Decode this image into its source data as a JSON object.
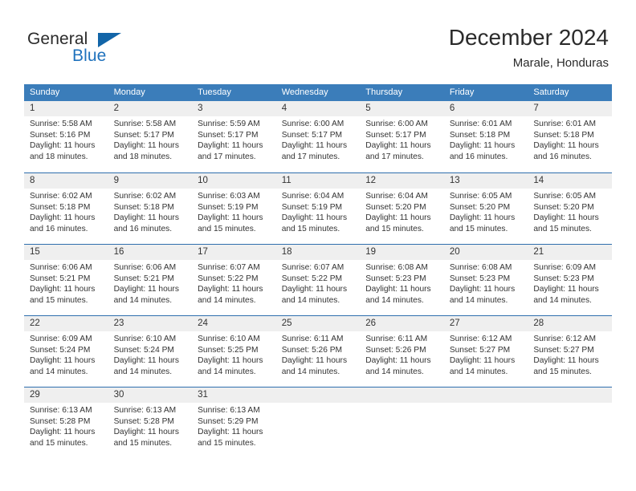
{
  "brand": {
    "name_part1": "General",
    "name_part2": "Blue",
    "accent_color": "#1265a8"
  },
  "header": {
    "title": "December 2024",
    "subtitle": "Marale, Honduras"
  },
  "theme": {
    "header_row_bg": "#3b7dba",
    "week_separator": "#2f6fae",
    "daynum_band_bg": "#efefef"
  },
  "weekdays": [
    "Sunday",
    "Monday",
    "Tuesday",
    "Wednesday",
    "Thursday",
    "Friday",
    "Saturday"
  ],
  "weeks": [
    [
      {
        "day": "1",
        "sunrise": "Sunrise: 5:58 AM",
        "sunset": "Sunset: 5:16 PM",
        "daylight1": "Daylight: 11 hours",
        "daylight2": "and 18 minutes."
      },
      {
        "day": "2",
        "sunrise": "Sunrise: 5:58 AM",
        "sunset": "Sunset: 5:17 PM",
        "daylight1": "Daylight: 11 hours",
        "daylight2": "and 18 minutes."
      },
      {
        "day": "3",
        "sunrise": "Sunrise: 5:59 AM",
        "sunset": "Sunset: 5:17 PM",
        "daylight1": "Daylight: 11 hours",
        "daylight2": "and 17 minutes."
      },
      {
        "day": "4",
        "sunrise": "Sunrise: 6:00 AM",
        "sunset": "Sunset: 5:17 PM",
        "daylight1": "Daylight: 11 hours",
        "daylight2": "and 17 minutes."
      },
      {
        "day": "5",
        "sunrise": "Sunrise: 6:00 AM",
        "sunset": "Sunset: 5:17 PM",
        "daylight1": "Daylight: 11 hours",
        "daylight2": "and 17 minutes."
      },
      {
        "day": "6",
        "sunrise": "Sunrise: 6:01 AM",
        "sunset": "Sunset: 5:18 PM",
        "daylight1": "Daylight: 11 hours",
        "daylight2": "and 16 minutes."
      },
      {
        "day": "7",
        "sunrise": "Sunrise: 6:01 AM",
        "sunset": "Sunset: 5:18 PM",
        "daylight1": "Daylight: 11 hours",
        "daylight2": "and 16 minutes."
      }
    ],
    [
      {
        "day": "8",
        "sunrise": "Sunrise: 6:02 AM",
        "sunset": "Sunset: 5:18 PM",
        "daylight1": "Daylight: 11 hours",
        "daylight2": "and 16 minutes."
      },
      {
        "day": "9",
        "sunrise": "Sunrise: 6:02 AM",
        "sunset": "Sunset: 5:18 PM",
        "daylight1": "Daylight: 11 hours",
        "daylight2": "and 16 minutes."
      },
      {
        "day": "10",
        "sunrise": "Sunrise: 6:03 AM",
        "sunset": "Sunset: 5:19 PM",
        "daylight1": "Daylight: 11 hours",
        "daylight2": "and 15 minutes."
      },
      {
        "day": "11",
        "sunrise": "Sunrise: 6:04 AM",
        "sunset": "Sunset: 5:19 PM",
        "daylight1": "Daylight: 11 hours",
        "daylight2": "and 15 minutes."
      },
      {
        "day": "12",
        "sunrise": "Sunrise: 6:04 AM",
        "sunset": "Sunset: 5:20 PM",
        "daylight1": "Daylight: 11 hours",
        "daylight2": "and 15 minutes."
      },
      {
        "day": "13",
        "sunrise": "Sunrise: 6:05 AM",
        "sunset": "Sunset: 5:20 PM",
        "daylight1": "Daylight: 11 hours",
        "daylight2": "and 15 minutes."
      },
      {
        "day": "14",
        "sunrise": "Sunrise: 6:05 AM",
        "sunset": "Sunset: 5:20 PM",
        "daylight1": "Daylight: 11 hours",
        "daylight2": "and 15 minutes."
      }
    ],
    [
      {
        "day": "15",
        "sunrise": "Sunrise: 6:06 AM",
        "sunset": "Sunset: 5:21 PM",
        "daylight1": "Daylight: 11 hours",
        "daylight2": "and 15 minutes."
      },
      {
        "day": "16",
        "sunrise": "Sunrise: 6:06 AM",
        "sunset": "Sunset: 5:21 PM",
        "daylight1": "Daylight: 11 hours",
        "daylight2": "and 14 minutes."
      },
      {
        "day": "17",
        "sunrise": "Sunrise: 6:07 AM",
        "sunset": "Sunset: 5:22 PM",
        "daylight1": "Daylight: 11 hours",
        "daylight2": "and 14 minutes."
      },
      {
        "day": "18",
        "sunrise": "Sunrise: 6:07 AM",
        "sunset": "Sunset: 5:22 PM",
        "daylight1": "Daylight: 11 hours",
        "daylight2": "and 14 minutes."
      },
      {
        "day": "19",
        "sunrise": "Sunrise: 6:08 AM",
        "sunset": "Sunset: 5:23 PM",
        "daylight1": "Daylight: 11 hours",
        "daylight2": "and 14 minutes."
      },
      {
        "day": "20",
        "sunrise": "Sunrise: 6:08 AM",
        "sunset": "Sunset: 5:23 PM",
        "daylight1": "Daylight: 11 hours",
        "daylight2": "and 14 minutes."
      },
      {
        "day": "21",
        "sunrise": "Sunrise: 6:09 AM",
        "sunset": "Sunset: 5:23 PM",
        "daylight1": "Daylight: 11 hours",
        "daylight2": "and 14 minutes."
      }
    ],
    [
      {
        "day": "22",
        "sunrise": "Sunrise: 6:09 AM",
        "sunset": "Sunset: 5:24 PM",
        "daylight1": "Daylight: 11 hours",
        "daylight2": "and 14 minutes."
      },
      {
        "day": "23",
        "sunrise": "Sunrise: 6:10 AM",
        "sunset": "Sunset: 5:24 PM",
        "daylight1": "Daylight: 11 hours",
        "daylight2": "and 14 minutes."
      },
      {
        "day": "24",
        "sunrise": "Sunrise: 6:10 AM",
        "sunset": "Sunset: 5:25 PM",
        "daylight1": "Daylight: 11 hours",
        "daylight2": "and 14 minutes."
      },
      {
        "day": "25",
        "sunrise": "Sunrise: 6:11 AM",
        "sunset": "Sunset: 5:26 PM",
        "daylight1": "Daylight: 11 hours",
        "daylight2": "and 14 minutes."
      },
      {
        "day": "26",
        "sunrise": "Sunrise: 6:11 AM",
        "sunset": "Sunset: 5:26 PM",
        "daylight1": "Daylight: 11 hours",
        "daylight2": "and 14 minutes."
      },
      {
        "day": "27",
        "sunrise": "Sunrise: 6:12 AM",
        "sunset": "Sunset: 5:27 PM",
        "daylight1": "Daylight: 11 hours",
        "daylight2": "and 14 minutes."
      },
      {
        "day": "28",
        "sunrise": "Sunrise: 6:12 AM",
        "sunset": "Sunset: 5:27 PM",
        "daylight1": "Daylight: 11 hours",
        "daylight2": "and 15 minutes."
      }
    ],
    [
      {
        "day": "29",
        "sunrise": "Sunrise: 6:13 AM",
        "sunset": "Sunset: 5:28 PM",
        "daylight1": "Daylight: 11 hours",
        "daylight2": "and 15 minutes."
      },
      {
        "day": "30",
        "sunrise": "Sunrise: 6:13 AM",
        "sunset": "Sunset: 5:28 PM",
        "daylight1": "Daylight: 11 hours",
        "daylight2": "and 15 minutes."
      },
      {
        "day": "31",
        "sunrise": "Sunrise: 6:13 AM",
        "sunset": "Sunset: 5:29 PM",
        "daylight1": "Daylight: 11 hours",
        "daylight2": "and 15 minutes."
      },
      {
        "day": "",
        "sunrise": "",
        "sunset": "",
        "daylight1": "",
        "daylight2": ""
      },
      {
        "day": "",
        "sunrise": "",
        "sunset": "",
        "daylight1": "",
        "daylight2": ""
      },
      {
        "day": "",
        "sunrise": "",
        "sunset": "",
        "daylight1": "",
        "daylight2": ""
      },
      {
        "day": "",
        "sunrise": "",
        "sunset": "",
        "daylight1": "",
        "daylight2": ""
      }
    ]
  ]
}
